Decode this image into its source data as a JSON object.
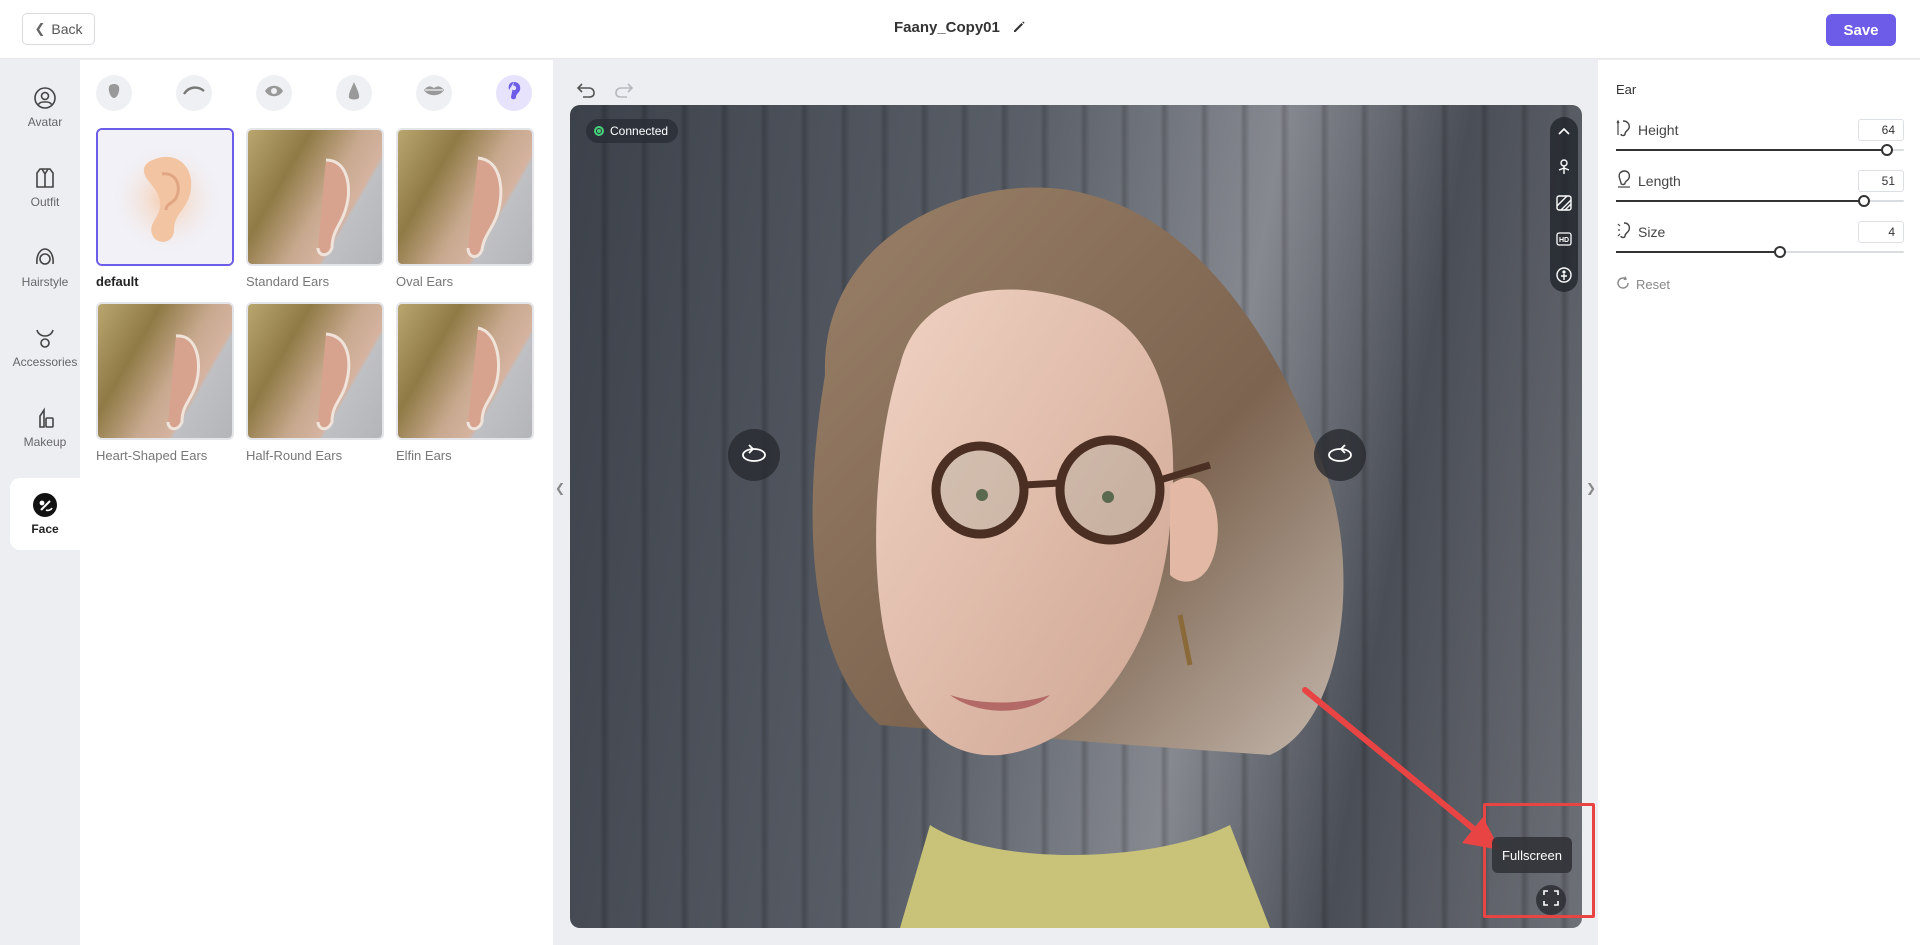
{
  "header": {
    "back_label": "Back",
    "doc_title": "Faany_Copy01",
    "save_label": "Save"
  },
  "nav": {
    "items": [
      {
        "label": "Avatar",
        "icon": "avatar-icon"
      },
      {
        "label": "Outfit",
        "icon": "outfit-icon"
      },
      {
        "label": "Hairstyle",
        "icon": "hairstyle-icon"
      },
      {
        "label": "Accessories",
        "icon": "accessories-icon"
      },
      {
        "label": "Makeup",
        "icon": "makeup-icon"
      },
      {
        "label": "Face",
        "icon": "face-icon",
        "active": true
      }
    ]
  },
  "categories": [
    {
      "icon": "face-shape-icon"
    },
    {
      "icon": "eyebrow-icon"
    },
    {
      "icon": "eye-icon"
    },
    {
      "icon": "nose-icon"
    },
    {
      "icon": "lips-icon"
    },
    {
      "icon": "ear-icon",
      "active": true
    }
  ],
  "presets": [
    {
      "label": "default",
      "selected": true
    },
    {
      "label": "Standard Ears"
    },
    {
      "label": "Oval Ears"
    },
    {
      "label": "Heart-Shaped Ears"
    },
    {
      "label": "Half-Round Ears"
    },
    {
      "label": "Elfin Ears"
    }
  ],
  "viewport": {
    "status": "Connected",
    "tooltip": "Fullscreen",
    "toolbar_icons": [
      "collapse-up-icon",
      "pose-icon",
      "background-icon",
      "hd-icon",
      "body-icon"
    ]
  },
  "ear_panel": {
    "title": "Ear",
    "sliders": [
      {
        "label": "Height",
        "value": "64",
        "fraction": 0.94
      },
      {
        "label": "Length",
        "value": "51",
        "fraction": 0.86
      },
      {
        "label": "Size",
        "value": "4",
        "fraction": 0.57
      }
    ],
    "reset_label": "Reset"
  },
  "colors": {
    "accent": "#6c5ce7",
    "annotation": "#e94444",
    "connected": "#46d17a"
  }
}
